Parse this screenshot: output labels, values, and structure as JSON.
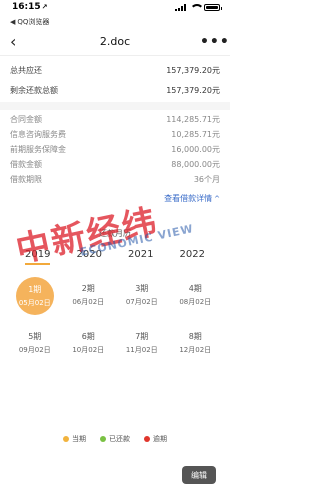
{
  "status_bar": {
    "time": "16:15",
    "location_arrow": "↗"
  },
  "back_app": {
    "arrow": "◀",
    "label": "QQ浏览器"
  },
  "navbar": {
    "back": "‹",
    "title": "2.doc",
    "more": "•••"
  },
  "summary": [
    {
      "label": "总共应还",
      "value": "157,379.20元"
    },
    {
      "label": "剩余还款总额",
      "value": "157,379.20元"
    }
  ],
  "details": [
    {
      "label": "合同金额",
      "value": "114,285.71元"
    },
    {
      "label": "信息咨询服务费",
      "value": "10,285.71元"
    },
    {
      "label": "前期服务保障金",
      "value": "16,000.00元"
    },
    {
      "label": "借款金额",
      "value": "88,000.00元"
    },
    {
      "label": "借款期限",
      "value": "36个月"
    }
  ],
  "detail_link": {
    "label": "查看借款详情",
    "arrow": "^"
  },
  "plan": {
    "title": "还款月历",
    "years": [
      "2019",
      "2020",
      "2021",
      "2022"
    ],
    "active_year": "2019",
    "periods": [
      {
        "label": "1期",
        "date": "05月02日"
      },
      {
        "label": "2期",
        "date": "06月02日"
      },
      {
        "label": "3期",
        "date": "07月02日"
      },
      {
        "label": "4期",
        "date": "08月02日"
      },
      {
        "label": "5期",
        "date": "09月02日"
      },
      {
        "label": "6期",
        "date": "10月02日"
      },
      {
        "label": "7期",
        "date": "11月02日"
      },
      {
        "label": "8期",
        "date": "12月02日"
      }
    ]
  },
  "legend": [
    {
      "label": "当期",
      "color": "#f2b33d"
    },
    {
      "label": "已还款",
      "color": "#7ac143"
    },
    {
      "label": "逾期",
      "color": "#e0362c"
    }
  ],
  "edit_button": "编辑",
  "watermark": {
    "text": "中新经纬",
    "english": "ECONOMIC VIEW"
  }
}
